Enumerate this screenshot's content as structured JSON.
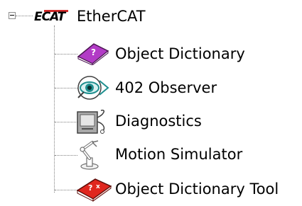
{
  "tree": {
    "root": {
      "label": "EtherCAT",
      "icon": "ethercat-logo-icon",
      "logo_text": "ECAT",
      "expanded": true
    },
    "children": [
      {
        "label": "Object Dictionary",
        "icon": "book-icon"
      },
      {
        "label": "402 Observer",
        "icon": "observer-eye-icon"
      },
      {
        "label": "Diagnostics",
        "icon": "diagnostics-icon"
      },
      {
        "label": "Motion Simulator",
        "icon": "robot-arm-icon"
      },
      {
        "label": "Object Dictionary Tool",
        "icon": "dictionary-tool-icon"
      }
    ]
  },
  "colors": {
    "connector": "#808080",
    "logo_red": "#d32b2b",
    "book_purple": "#b23bc6",
    "eye_teal": "#1f8f8f",
    "tool_red": "#e0261e"
  }
}
